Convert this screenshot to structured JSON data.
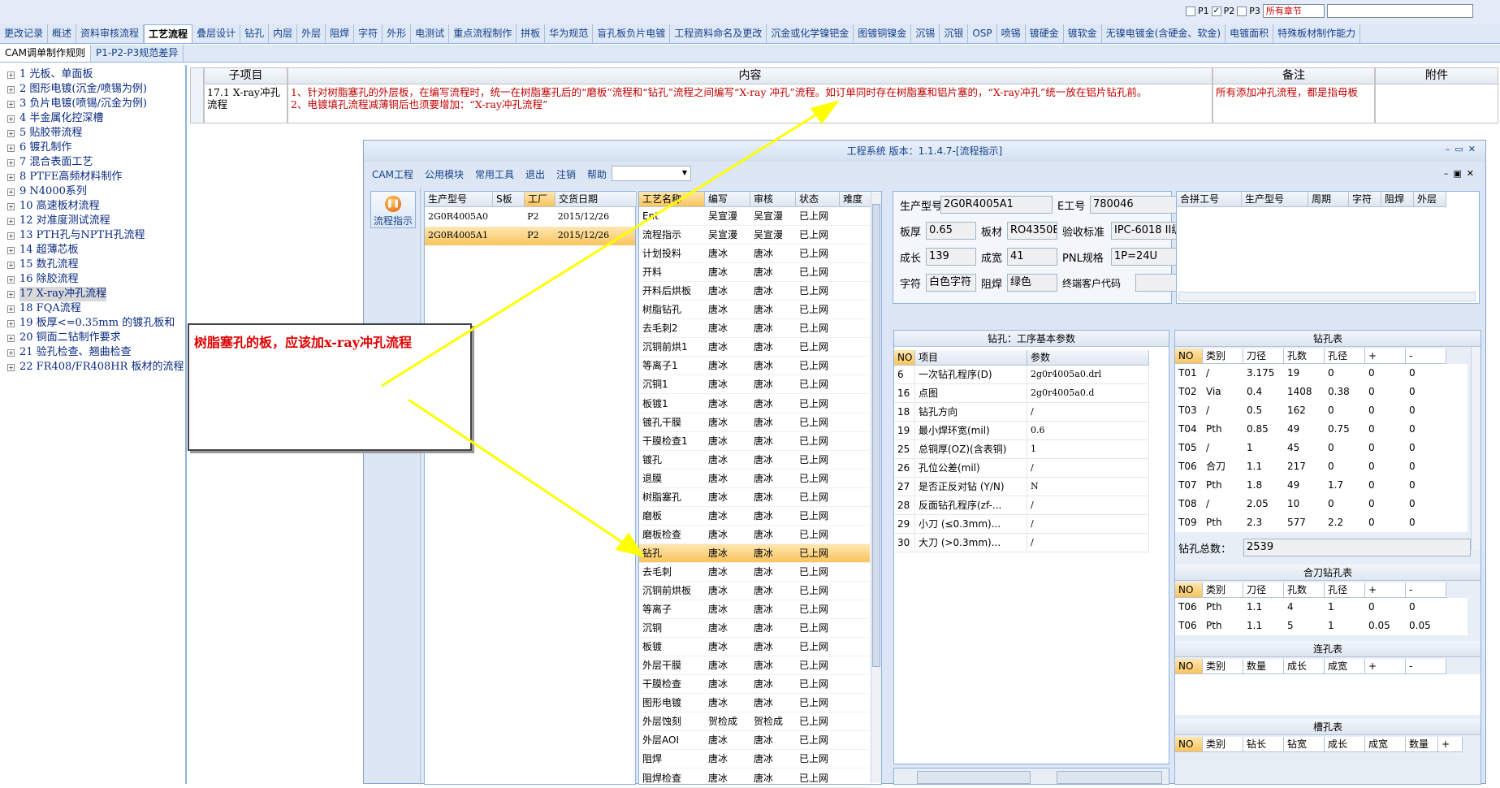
{
  "chapter_bar": {
    "p1": "P1",
    "p2": "P2",
    "p3": "P3",
    "section_select": "所有章节"
  },
  "tabs_row1": [
    "更改记录",
    "概述",
    "资料审核流程",
    "工艺流程",
    "叠层设计",
    "钻孔",
    "内层",
    "外层",
    "阻焊",
    "字符",
    "外形",
    "电测试",
    "重点流程制作",
    "拼板",
    "华为规范",
    "盲孔板负片电镀",
    "工程资料命名及更改",
    "沉金或化学镍钯金",
    "图镀铜镍金",
    "沉锡",
    "沉银",
    "OSP",
    "喷锡",
    "镀硬金",
    "镀软金",
    "无镍电镀金(含硬金、软金)",
    "电镀面积",
    "特殊板材制作能力"
  ],
  "tabs_row2": [
    "CAM调单制作规则",
    "P1-P2-P3规范差异"
  ],
  "tree_items": [
    "1 光板、单面板",
    "2 图形电镀(沉金/喷锡为例)",
    "3 负片电镀(喷锡/沉金为例)",
    "4 半金属化控深槽",
    "5 贴胶带流程",
    "6 镀孔制作",
    "7 混合表面工艺",
    "8 PTFE高频材料制作",
    "9 N4000系列",
    "10 高速板材流程",
    "12 对准度测试流程",
    "13 PTH孔与NPTH孔流程",
    "14 超薄芯板",
    "15 数孔流程",
    "16 除胶流程",
    "17 X-ray冲孔流程",
    "18 FQA流程",
    "19 板厚<=0.35mm 的镀孔板和",
    "20 铜面二钻制作要求",
    "21 验孔检查、翘曲检查",
    "22 FR408/FR408HR 板材的流程"
  ],
  "grid": {
    "headers": {
      "subitem": "子项目",
      "content": "内容",
      "remark": "备注",
      "attach": "附件"
    },
    "subitem": "17.1 X-ray冲孔流程",
    "content_line1": "1、针对树脂塞孔的外层板，在编写流程时，统一在树脂塞孔后的“磨板”流程和“钻孔”流程之间编写“X-ray 冲孔”流程。如订单同时存在树脂塞和铝片塞的，“X-ray冲孔”统一放在铝片钻孔前。",
    "content_line2": "2、电镀填孔流程减薄铜后也须要增加：“X-ray冲孔流程”",
    "remark": "所有添加冲孔流程，都是指母板"
  },
  "callout": "树脂塞孔的板，应该加x-ray冲孔流程",
  "window": {
    "title": "工程系统 版本：1.1.4.7-[流程指示]",
    "menu": [
      "CAM工程",
      "公用模块",
      "常用工具",
      "退出",
      "注销",
      "帮助"
    ],
    "side_button": "流程指示",
    "model_headers": [
      "生产型号",
      "S板",
      "工厂",
      "交货日期"
    ],
    "models": [
      [
        "2G0R4005A0",
        "",
        "P2",
        "2015/12/26"
      ],
      [
        "2G0R4005A1",
        "",
        "P2",
        "2015/12/26"
      ]
    ],
    "proc_headers": [
      "工艺名称",
      "编写",
      "审核",
      "状态",
      "难度"
    ],
    "procs": [
      [
        "Ent",
        "吴宣漫",
        "吴宣漫",
        "已上网"
      ],
      [
        "流程指示",
        "吴宣漫",
        "吴宣漫",
        "已上网"
      ],
      [
        "计划投料",
        "唐冰",
        "唐冰",
        "已上网"
      ],
      [
        "开料",
        "唐冰",
        "唐冰",
        "已上网"
      ],
      [
        "开料后烘板",
        "唐冰",
        "唐冰",
        "已上网"
      ],
      [
        "树脂钻孔",
        "唐冰",
        "唐冰",
        "已上网"
      ],
      [
        "去毛刺2",
        "唐冰",
        "唐冰",
        "已上网"
      ],
      [
        "沉铜前烘1",
        "唐冰",
        "唐冰",
        "已上网"
      ],
      [
        "等离子1",
        "唐冰",
        "唐冰",
        "已上网"
      ],
      [
        "沉铜1",
        "唐冰",
        "唐冰",
        "已上网"
      ],
      [
        "板镀1",
        "唐冰",
        "唐冰",
        "已上网"
      ],
      [
        "镀孔干膜",
        "唐冰",
        "唐冰",
        "已上网"
      ],
      [
        "干膜检查1",
        "唐冰",
        "唐冰",
        "已上网"
      ],
      [
        "镀孔",
        "唐冰",
        "唐冰",
        "已上网"
      ],
      [
        "退膜",
        "唐冰",
        "唐冰",
        "已上网"
      ],
      [
        "树脂塞孔",
        "唐冰",
        "唐冰",
        "已上网"
      ],
      [
        "磨板",
        "唐冰",
        "唐冰",
        "已上网"
      ],
      [
        "磨板检查",
        "唐冰",
        "唐冰",
        "已上网"
      ],
      [
        "钻孔",
        "唐冰",
        "唐冰",
        "已上网"
      ],
      [
        "去毛刺",
        "唐冰",
        "唐冰",
        "已上网"
      ],
      [
        "沉铜前烘板",
        "唐冰",
        "唐冰",
        "已上网"
      ],
      [
        "等离子",
        "唐冰",
        "唐冰",
        "已上网"
      ],
      [
        "沉铜",
        "唐冰",
        "唐冰",
        "已上网"
      ],
      [
        "板镀",
        "唐冰",
        "唐冰",
        "已上网"
      ],
      [
        "外层干膜",
        "唐冰",
        "唐冰",
        "已上网"
      ],
      [
        "干膜检查",
        "唐冰",
        "唐冰",
        "已上网"
      ],
      [
        "图形电镀",
        "唐冰",
        "唐冰",
        "已上网"
      ],
      [
        "外层蚀刻",
        "贺检成",
        "贺检成",
        "已上网"
      ],
      [
        "外层AOI",
        "唐冰",
        "唐冰",
        "已上网"
      ],
      [
        "阻焊",
        "唐冰",
        "唐冰",
        "已上网"
      ],
      [
        "阻焊检查",
        "唐冰",
        "唐冰",
        "已上网"
      ]
    ],
    "info": {
      "model_label": "生产型号",
      "model": "2G0R4005A1",
      "e_label": "E工号",
      "e_no": "780046",
      "thick_label": "板厚",
      "thick": "0.65",
      "mat_label": "板材",
      "mat": "RO4350B",
      "std_label": "验收标准",
      "std": "IPC-6018 II级",
      "len_label": "成长",
      "len": "139",
      "wid_label": "成宽",
      "wid": "41",
      "pnl_label": "PNL规格",
      "pnl": "1P=24U",
      "char_label": "字符",
      "char": "白色字符",
      "mask_label": "阻焊",
      "mask": "绿色",
      "cust_label": "终端客户代码",
      "cust": ""
    },
    "merge_headers": [
      "合拼工号",
      "生产型号",
      "周期",
      "字符",
      "阻焊",
      "外层"
    ],
    "drill_title": "钻孔：工序基本参数",
    "drill_headers": [
      "NO",
      "项目",
      "参数"
    ],
    "drill_rows": [
      [
        "6",
        "一次钻孔程序(D)",
        "2g0r4005a0.drl"
      ],
      [
        "16",
        "点图",
        "2g0r4005a0.d"
      ],
      [
        "18",
        "钻孔方向",
        "/"
      ],
      [
        "19",
        "最小焊环宽(mil)",
        "0.6"
      ],
      [
        "25",
        "总铜厚(OZ)(含表铜)",
        "1"
      ],
      [
        "26",
        "孔位公差(mil)",
        "/"
      ],
      [
        "27",
        "是否正反对钻 (Y/N)",
        "N"
      ],
      [
        "28",
        "反面钻孔程序(zf-...",
        "/"
      ],
      [
        "29",
        "小刀 (≤0.3mm)...",
        "/"
      ],
      [
        "30",
        "大刀 (>0.3mm)...",
        "/"
      ]
    ],
    "hole_title": "钻孔表",
    "hole_headers": [
      "NO",
      "类别",
      "刀径",
      "孔数",
      "孔径",
      "+",
      "-"
    ],
    "hole_rows": [
      [
        "T01",
        "/",
        "3.175",
        "19",
        "0",
        "0",
        "0"
      ],
      [
        "T02",
        "Via",
        "0.4",
        "1408",
        "0.38",
        "0",
        "0"
      ],
      [
        "T03",
        "/",
        "0.5",
        "162",
        "0",
        "0",
        "0"
      ],
      [
        "T04",
        "Pth",
        "0.85",
        "49",
        "0.75",
        "0",
        "0"
      ],
      [
        "T05",
        "/",
        "1",
        "45",
        "0",
        "0",
        "0"
      ],
      [
        "T06",
        "合刀",
        "1.1",
        "217",
        "0",
        "0",
        "0"
      ],
      [
        "T07",
        "Pth",
        "1.8",
        "49",
        "1.7",
        "0",
        "0"
      ],
      [
        "T08",
        "/",
        "2.05",
        "10",
        "0",
        "0",
        "0"
      ],
      [
        "T09",
        "Pth",
        "2.3",
        "577",
        "2.2",
        "0",
        "0"
      ]
    ],
    "hole_total_label": "钻孔总数：",
    "hole_total": "2539",
    "combine_title": "合刀钻孔表",
    "combine_headers": [
      "NO",
      "类别",
      "刀径",
      "孔数",
      "孔径",
      "+",
      "-"
    ],
    "combine_rows": [
      [
        "T06",
        "Pth",
        "1.1",
        "4",
        "1",
        "0",
        "0"
      ],
      [
        "T06",
        "Pth",
        "1.1",
        "5",
        "1",
        "0.05",
        "0.05"
      ]
    ],
    "slot_title": "连孔表",
    "slot_headers": [
      "NO",
      "类别",
      "数量",
      "成长mm",
      "成宽mm",
      "+",
      "-"
    ],
    "groove_title": "槽孔表",
    "groove_headers": [
      "NO",
      "类别",
      "钻长mm",
      "钻宽mm",
      "成长mm",
      "成宽mm",
      "数量",
      "+"
    ]
  }
}
